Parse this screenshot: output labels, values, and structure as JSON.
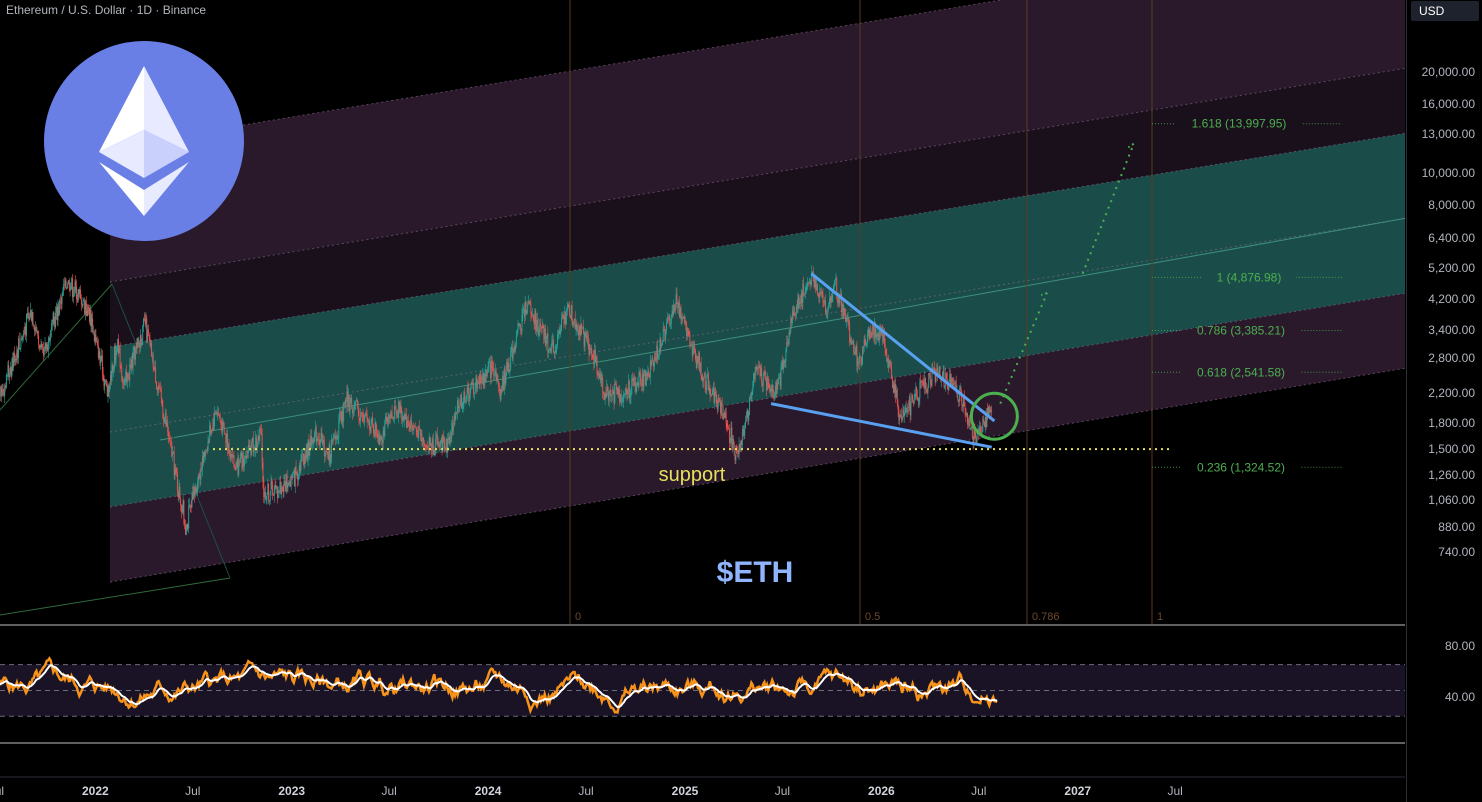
{
  "header": {
    "title": "Ethereum / U.S. Dollar · 1D · Binance",
    "currency": "USD"
  },
  "logo": {
    "icon": "ethereum-logo-icon",
    "color": "#6a7fe6"
  },
  "chart_data": {
    "type": "candlestick",
    "title": "Ethereum / U.S. Dollar · 1D · Binance",
    "scale": "log",
    "ylim": [
      700,
      21000
    ],
    "price_ticks": [
      "20,000.00",
      "16,000.00",
      "13,000.00",
      "10,000.00",
      "8,000.00",
      "6,400.00",
      "5,200.00",
      "4,200.00",
      "3,400.00",
      "2,800.00",
      "2,200.00",
      "1,800.00",
      "1,500.00",
      "1,260.00",
      "1,060.00",
      "880.00",
      "740.00"
    ],
    "price_tick_values": [
      20000,
      16000,
      13000,
      10000,
      8000,
      6400,
      5200,
      4200,
      3400,
      2800,
      2200,
      1800,
      1500,
      1260,
      1060,
      880,
      740
    ],
    "time_ticks": [
      {
        "label": "Jul",
        "date": "2021-07-01",
        "year": false
      },
      {
        "label": "2022",
        "date": "2022-01-01",
        "year": true
      },
      {
        "label": "Jul",
        "date": "2022-07-01",
        "year": false
      },
      {
        "label": "2023",
        "date": "2023-01-01",
        "year": true
      },
      {
        "label": "Jul",
        "date": "2023-07-01",
        "year": false
      },
      {
        "label": "2024",
        "date": "2024-01-01",
        "year": true
      },
      {
        "label": "Jul",
        "date": "2024-07-01",
        "year": false
      },
      {
        "label": "2025",
        "date": "2025-01-01",
        "year": true
      },
      {
        "label": "Jul",
        "date": "2025-07-01",
        "year": false
      },
      {
        "label": "2026",
        "date": "2026-01-01",
        "year": true
      },
      {
        "label": "Jul",
        "date": "2026-07-01",
        "year": false
      },
      {
        "label": "2027",
        "date": "2027-01-01",
        "year": true
      },
      {
        "label": "Jul",
        "date": "2027-07-01",
        "year": false
      }
    ],
    "price_path": [
      [
        "2021-05-01",
        2300
      ],
      [
        "2021-05-20",
        4100
      ],
      [
        "2021-06-25",
        1900
      ],
      [
        "2021-08-15",
        3200
      ],
      [
        "2021-09-05",
        3900
      ],
      [
        "2021-09-25",
        2800
      ],
      [
        "2021-11-10",
        4850
      ],
      [
        "2021-12-20",
        3900
      ],
      [
        "2022-01-24",
        2200
      ],
      [
        "2022-02-10",
        3100
      ],
      [
        "2022-02-24",
        2300
      ],
      [
        "2022-04-03",
        3550
      ],
      [
        "2022-05-12",
        1800
      ],
      [
        "2022-06-18",
        880
      ],
      [
        "2022-08-14",
        2000
      ],
      [
        "2022-09-20",
        1300
      ],
      [
        "2022-11-05",
        1650
      ],
      [
        "2022-11-10",
        1100
      ],
      [
        "2022-12-31",
        1200
      ],
      [
        "2023-02-15",
        1700
      ],
      [
        "2023-03-10",
        1420
      ],
      [
        "2023-04-15",
        2100
      ],
      [
        "2023-06-15",
        1650
      ],
      [
        "2023-07-15",
        2000
      ],
      [
        "2023-09-10",
        1550
      ],
      [
        "2023-10-20",
        1580
      ],
      [
        "2023-11-10",
        2100
      ],
      [
        "2024-01-12",
        2650
      ],
      [
        "2024-01-23",
        2200
      ],
      [
        "2024-03-12",
        4070
      ],
      [
        "2024-05-01",
        2900
      ],
      [
        "2024-05-27",
        3950
      ],
      [
        "2024-07-10",
        3000
      ],
      [
        "2024-08-05",
        2200
      ],
      [
        "2024-09-06",
        2200
      ],
      [
        "2024-10-25",
        2500
      ],
      [
        "2024-12-16",
        4100
      ],
      [
        "2025-01-10",
        3200
      ],
      [
        "2025-02-03",
        2500
      ],
      [
        "2025-03-10",
        1950
      ],
      [
        "2025-04-09",
        1400
      ],
      [
        "2025-05-13",
        2600
      ],
      [
        "2025-06-22",
        2200
      ],
      [
        "2025-07-20",
        3800
      ],
      [
        "2025-08-24",
        4950
      ],
      [
        "2025-09-25",
        3850
      ],
      [
        "2025-10-06",
        4700
      ],
      [
        "2025-11-04",
        3300
      ],
      [
        "2025-11-21",
        2650
      ],
      [
        "2025-12-10",
        3400
      ],
      [
        "2026-01-05",
        3200
      ],
      [
        "2026-02-05",
        1900
      ],
      [
        "2026-02-25",
        2050
      ],
      [
        "2026-03-15",
        2300
      ],
      [
        "2026-04-20",
        2550
      ],
      [
        "2026-06-01",
        2100
      ],
      [
        "2026-06-25",
        1600
      ],
      [
        "2026-07-10",
        1800
      ],
      [
        "2026-07-25",
        2000
      ]
    ],
    "fib_levels": [
      {
        "label": "1.618 (13,997.95)",
        "value": 13997.95
      },
      {
        "label": "1 (4,876.98)",
        "value": 4876.98
      },
      {
        "label": "0.786 (3,385.21)",
        "value": 3385.21
      },
      {
        "label": "0.618 (2,541.58)",
        "value": 2541.58
      },
      {
        "label": "0.236 (1,324.52)",
        "value": 1324.52
      }
    ],
    "time_fib_labels": [
      "0",
      "0.5",
      "0.786",
      "1"
    ],
    "annotations": {
      "support_label": "support",
      "support_price": 1500,
      "ticker_label": "$ETH",
      "support_color": "#e6e05a",
      "ticker_color": "#8fb5ff"
    },
    "colors": {
      "up": "#26a69a",
      "down": "#ef5350",
      "channel_mid": "#1f5a57",
      "channel_outer": "#4a2d4c",
      "trendline": "#5aa0f0",
      "target_circle": "#4caf50",
      "fib_text": "#4caf50",
      "rsi": "#f7931a",
      "rsi_ma": "#ffffff"
    },
    "rsi": {
      "ticks": [
        "80.00",
        "40.00"
      ],
      "tick_values": [
        80,
        40
      ],
      "bands": [
        70,
        50,
        30
      ],
      "range": [
        10,
        100
      ]
    }
  }
}
